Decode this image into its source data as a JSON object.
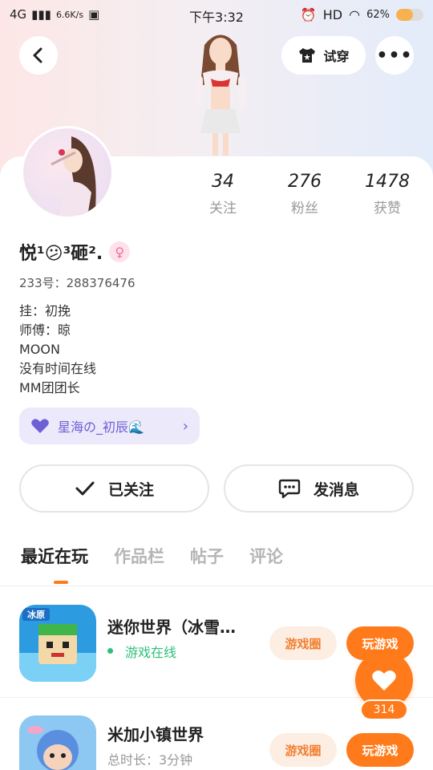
{
  "status_bar": {
    "network": "4G",
    "speed": "6.6K/s",
    "time": "下午3:32",
    "hd": "HD",
    "battery_text": "62%",
    "battery_level": 0.62
  },
  "header": {
    "tryon_label": "试穿",
    "more_label": "•••"
  },
  "profile": {
    "stats": [
      {
        "value": "34",
        "label": "关注"
      },
      {
        "value": "276",
        "label": "粉丝"
      },
      {
        "value": "1478",
        "label": "获赞"
      }
    ],
    "username": "悦¹😕³砸².",
    "gender_symbol": "♀",
    "uid": "233号：288376476",
    "bio_lines": [
      "挂：初挽",
      "师傅：晾",
      "MOON",
      "没有时间在线",
      "MM团团长"
    ],
    "club_label": "星海の_初辰🌊",
    "follow_label": "已关注",
    "message_label": "发消息"
  },
  "tabs": [
    {
      "label": "最近在玩",
      "active": true
    },
    {
      "label": "作品栏",
      "active": false
    },
    {
      "label": "帖子",
      "active": false
    },
    {
      "label": "评论",
      "active": false
    }
  ],
  "games": [
    {
      "title": "迷你世界（冰雪…",
      "subtitle": "游戏在线",
      "circle_label": "游戏圈",
      "play_label": "玩游戏",
      "icon_badge": "冰原"
    },
    {
      "title": "米加小镇世界",
      "subtitle": "总时长：3分钟",
      "circle_label": "游戏圈",
      "play_label": "玩游戏"
    }
  ],
  "like": {
    "count": "314"
  },
  "colors": {
    "accent": "#ff7a1a",
    "online": "#2ec07a",
    "club": "#6d5fd6"
  }
}
